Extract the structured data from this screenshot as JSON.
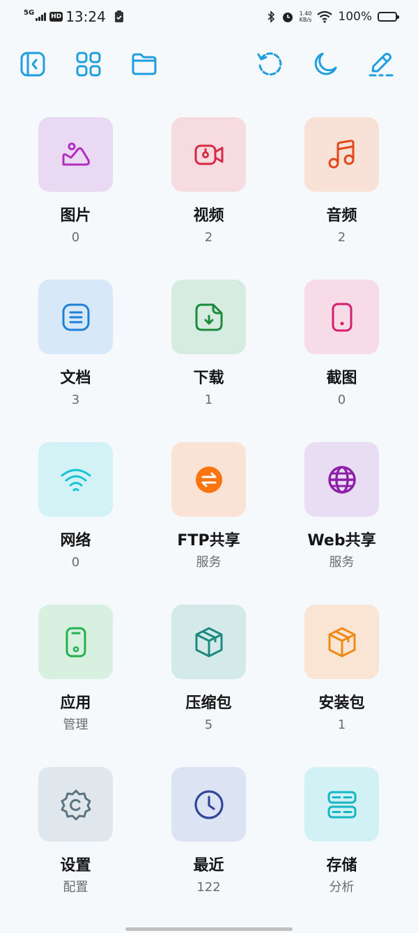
{
  "status_bar": {
    "network": "5G",
    "hd": "HD",
    "time": "13:24",
    "speed_value": "1.40",
    "speed_unit": "KB/s",
    "battery": "100%"
  },
  "toolbar": {
    "icons": [
      "collapse-sidebar-icon",
      "apps-grid-icon",
      "folder-icon",
      "history-icon",
      "moon-icon",
      "edit-icon"
    ],
    "accent": "#1e9ee0"
  },
  "tiles": [
    {
      "label": "图片",
      "sub": "0",
      "bg": "#ead9f2",
      "fg": "#b12cbf",
      "icon": "image-icon"
    },
    {
      "label": "视频",
      "sub": "2",
      "bg": "#f6dbe1",
      "fg": "#d82a45",
      "icon": "video-icon"
    },
    {
      "label": "音频",
      "sub": "2",
      "bg": "#f8e1d7",
      "fg": "#e4471a",
      "icon": "music-icon"
    },
    {
      "label": "文档",
      "sub": "3",
      "bg": "#d7e8f8",
      "fg": "#1d7fd8",
      "icon": "document-icon"
    },
    {
      "label": "下载",
      "sub": "1",
      "bg": "#d7ece0",
      "fg": "#1c8a3c",
      "icon": "download-icon"
    },
    {
      "label": "截图",
      "sub": "0",
      "bg": "#f7dbe6",
      "fg": "#d31f6e",
      "icon": "screenshot-icon"
    },
    {
      "label": "网络",
      "sub": "0",
      "bg": "#d3f2f6",
      "fg": "#16c3d6",
      "icon": "wifi-icon"
    },
    {
      "label": "FTP共享",
      "sub": "服务",
      "bg": "#fae3d5",
      "fg": "#fb7410",
      "icon": "ftp-share-icon"
    },
    {
      "label": "Web共享",
      "sub": "服务",
      "bg": "#e9ddf3",
      "fg": "#8e1fa8",
      "icon": "globe-icon"
    },
    {
      "label": "应用",
      "sub": "管理",
      "bg": "#d8f0e0",
      "fg": "#22b14c",
      "icon": "phone-icon"
    },
    {
      "label": "压缩包",
      "sub": "5",
      "bg": "#d3eae9",
      "fg": "#1d8a80",
      "icon": "archive-box-icon"
    },
    {
      "label": "安装包",
      "sub": "1",
      "bg": "#fae5d5",
      "fg": "#f08a16",
      "icon": "package-icon"
    },
    {
      "label": "设置",
      "sub": "配置",
      "bg": "#dfe6ec",
      "fg": "#5b7380",
      "icon": "gear-icon"
    },
    {
      "label": "最近",
      "sub": "122",
      "bg": "#dce4f4",
      "fg": "#30479b",
      "icon": "clock-icon"
    },
    {
      "label": "存储",
      "sub": "分析",
      "bg": "#d2f1f4",
      "fg": "#16b6c3",
      "icon": "storage-icon"
    }
  ]
}
